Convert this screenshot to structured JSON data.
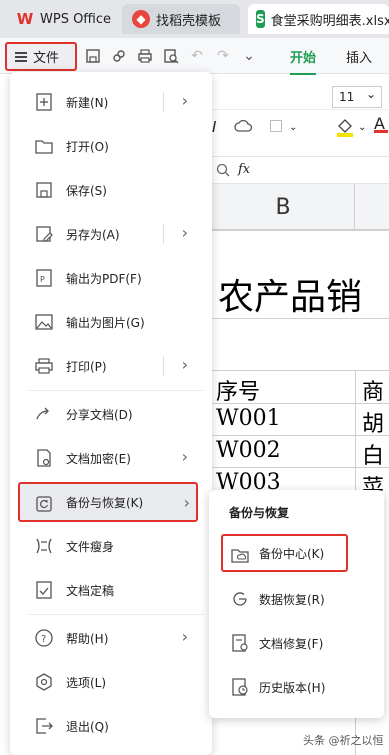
{
  "tabs": [
    {
      "label": "WPS Office",
      "icon": "wps-logo-icon"
    },
    {
      "label": "找稻壳模板",
      "icon": "docer-icon"
    },
    {
      "label": "食堂采购明细表.xlsx",
      "icon": "spreadsheet-icon"
    }
  ],
  "toolbar": {
    "file_label": "文件",
    "start_label": "开始",
    "insert_label": "插入"
  },
  "format": {
    "font_size": "11",
    "fx_label": "fx"
  },
  "sheet": {
    "column_b": "B",
    "title": "农产品销",
    "rows": [
      {
        "b": "序号",
        "c": "商"
      },
      {
        "b": "W001",
        "c": "胡"
      },
      {
        "b": "W002",
        "c": "白"
      },
      {
        "b": "W003",
        "c": "菜"
      }
    ]
  },
  "file_menu": {
    "items": [
      {
        "label": "新建(N)",
        "icon": "new-file-icon",
        "arrow": true
      },
      {
        "label": "打开(O)",
        "icon": "folder-open-icon",
        "arrow": false
      },
      {
        "label": "保存(S)",
        "icon": "save-icon",
        "arrow": false
      },
      {
        "label": "另存为(A)",
        "icon": "save-as-icon",
        "arrow": true
      },
      {
        "label": "输出为PDF(F)",
        "icon": "pdf-icon",
        "arrow": false
      },
      {
        "label": "输出为图片(G)",
        "icon": "image-icon",
        "arrow": false
      },
      {
        "label": "打印(P)",
        "icon": "print-icon",
        "arrow": true
      },
      {
        "label": "分享文档(D)",
        "icon": "share-icon",
        "arrow": false
      },
      {
        "label": "文档加密(E)",
        "icon": "lock-doc-icon",
        "arrow": true
      },
      {
        "label": "备份与恢复(K)",
        "icon": "backup-icon",
        "arrow": true
      },
      {
        "label": "文件瘦身",
        "icon": "slim-icon",
        "arrow": false
      },
      {
        "label": "文档定稿",
        "icon": "finalize-icon",
        "arrow": false
      },
      {
        "label": "帮助(H)",
        "icon": "help-icon",
        "arrow": true
      },
      {
        "label": "选项(L)",
        "icon": "settings-icon",
        "arrow": false
      },
      {
        "label": "退出(Q)",
        "icon": "exit-icon",
        "arrow": false
      }
    ]
  },
  "backup_submenu": {
    "title": "备份与恢复",
    "items": [
      {
        "label": "备份中心(K)",
        "icon": "backup-center-icon"
      },
      {
        "label": "数据恢复(R)",
        "icon": "data-recovery-icon"
      },
      {
        "label": "文档修复(F)",
        "icon": "doc-repair-icon"
      },
      {
        "label": "历史版本(H)",
        "icon": "history-icon"
      }
    ]
  },
  "watermark": "头条 @祈之以恒",
  "colors": {
    "highlight_border": "#e0312b",
    "accent_green": "#1f9d55"
  }
}
